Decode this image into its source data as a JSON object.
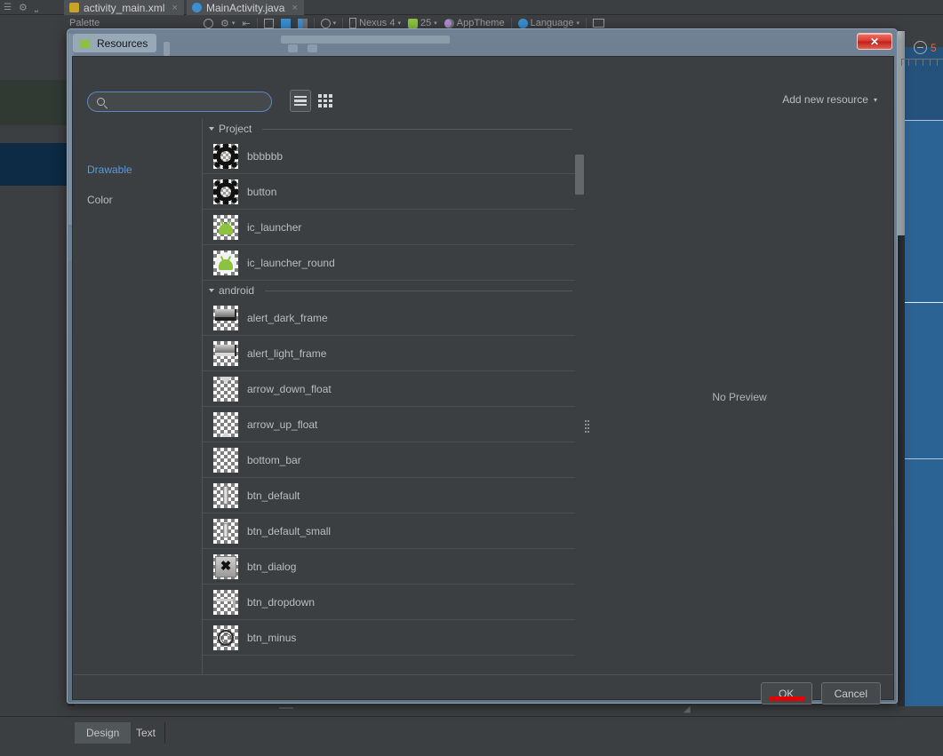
{
  "ide": {
    "editor_tabs": [
      {
        "label": "activity_main.xml",
        "icon": "xml-file-icon",
        "close": "×"
      },
      {
        "label": "MainActivity.java",
        "icon": "java-file-icon",
        "close": "×"
      }
    ],
    "palette_label": "Palette",
    "design_toolbar": [
      {
        "label": "",
        "icon": "refresh-icon"
      },
      {
        "label": "",
        "icon": "gear-icon"
      },
      {
        "label": "",
        "icon": "align-left-icon"
      },
      {
        "label": "",
        "icon": "split-layout-icon"
      },
      {
        "label": "",
        "icon": "blueprint-icon"
      },
      {
        "label": "",
        "icon": "design-blueprint-icon"
      },
      {
        "label": "",
        "icon": "orientation-icon"
      },
      {
        "label": "Nexus 4",
        "icon": "device-icon"
      },
      {
        "label": "25",
        "icon": "android-api-icon"
      },
      {
        "label": "AppTheme",
        "icon": "theme-icon"
      },
      {
        "label": "Language",
        "icon": "globe-icon"
      },
      {
        "label": "",
        "icon": "layout-variants-icon"
      }
    ],
    "zoom": {
      "minus": "−",
      "value": "5"
    },
    "bottom_tabs": [
      {
        "label": "Design",
        "selected": true
      },
      {
        "label": "Text",
        "selected": false
      }
    ]
  },
  "dialog": {
    "title": "Resources",
    "title_icon": "android-studio-icon",
    "close_label": "✕",
    "search": {
      "value": "",
      "placeholder": "",
      "icon": "search-icon"
    },
    "view_modes": [
      {
        "name": "list-view",
        "icon": "list-view-icon",
        "selected": true
      },
      {
        "name": "grid-view",
        "icon": "grid-view-icon",
        "selected": false
      }
    ],
    "add_new_resource": {
      "label": "Add new resource",
      "caret": "▾"
    },
    "categories": [
      {
        "label": "Drawable",
        "selected": true
      },
      {
        "label": "Color",
        "selected": false
      }
    ],
    "groups": [
      {
        "label": "Project",
        "expanded": true,
        "items": [
          {
            "name": "bbbbbb",
            "thumb": "cog-ninepatch-thumb"
          },
          {
            "name": "button",
            "thumb": "cog-ninepatch-thumb"
          },
          {
            "name": "ic_launcher",
            "thumb": "android-droid-thumb"
          },
          {
            "name": "ic_launcher_round",
            "thumb": "android-droid-round-thumb"
          }
        ]
      },
      {
        "label": "android",
        "expanded": true,
        "items": [
          {
            "name": "alert_dark_frame",
            "thumb": "alert-dark-frame-thumb"
          },
          {
            "name": "alert_light_frame",
            "thumb": "alert-light-frame-thumb"
          },
          {
            "name": "arrow_down_float",
            "thumb": "arrow-down-thumb"
          },
          {
            "name": "arrow_up_float",
            "thumb": "arrow-up-thumb"
          },
          {
            "name": "bottom_bar",
            "thumb": "bottom-bar-thumb"
          },
          {
            "name": "btn_default",
            "thumb": "btn-default-thumb"
          },
          {
            "name": "btn_default_small",
            "thumb": "btn-default-small-thumb"
          },
          {
            "name": "btn_dialog",
            "thumb": "btn-dialog-thumb"
          },
          {
            "name": "btn_dropdown",
            "thumb": "btn-dropdown-thumb"
          },
          {
            "name": "btn_minus",
            "thumb": "btn-minus-thumb"
          }
        ]
      }
    ],
    "preview": {
      "text": "No Preview"
    },
    "buttons": [
      {
        "label": "OK",
        "highlighted": true
      },
      {
        "label": "Cancel",
        "highlighted": false
      }
    ]
  },
  "colors": {
    "accent_blue": "#5b9ad8",
    "panel_bg": "#3c3f41",
    "close_red": "#d8382c",
    "highlight_red": "#e60000",
    "android_green": "#8cc23f",
    "preview_blue": "#2c6395",
    "zoom_orange": "#d06b4a"
  }
}
